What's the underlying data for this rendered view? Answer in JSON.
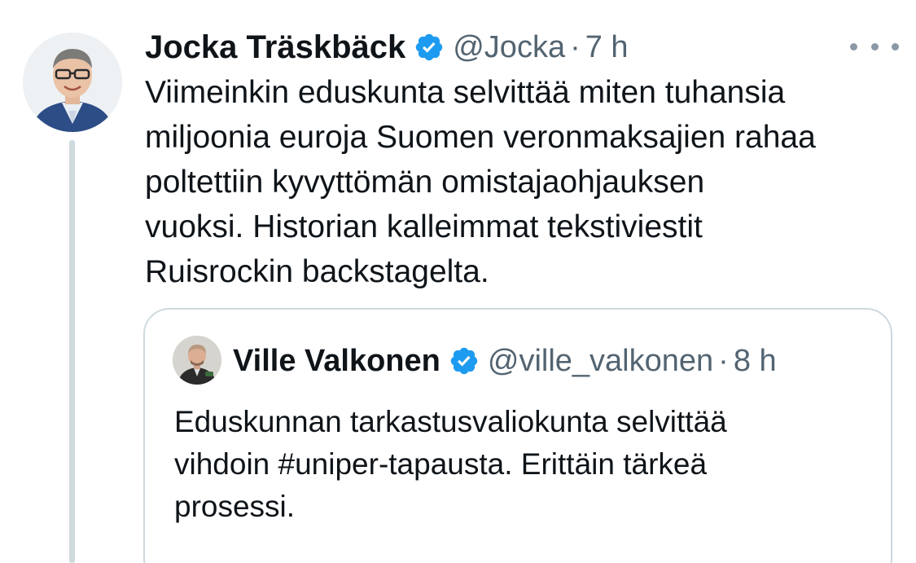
{
  "tweet": {
    "author_name": "Jocka Träskbäck",
    "handle": "@Jocka",
    "separator": "·",
    "time": "7 h",
    "body_lines": [
      "Viimeinkin eduskunta selvittää miten tuhansia",
      "miljoonia euroja Suomen veronmaksajien rahaa",
      "poltettiin kyvyttömän omistajaohjauksen",
      "vuoksi. Historian kalleimmat tekstiviestit",
      "Ruisrockin backstagelta."
    ]
  },
  "quote": {
    "author_name": "Ville Valkonen",
    "handle": "@ville_valkonen",
    "separator": "·",
    "time": "8 h",
    "body_lines": [
      "Eduskunnan tarkastusvaliokunta selvittää",
      "vihdoin #uniper-tapausta. Erittäin tärkeä",
      "prosessi."
    ]
  },
  "icons": {
    "verified": "verified-badge-icon",
    "more": "more-options-icon"
  },
  "colors": {
    "verified_blue": "#1d9bf0",
    "secondary_text": "#536471",
    "primary_text": "#0f1419",
    "border": "#cfd9de"
  }
}
